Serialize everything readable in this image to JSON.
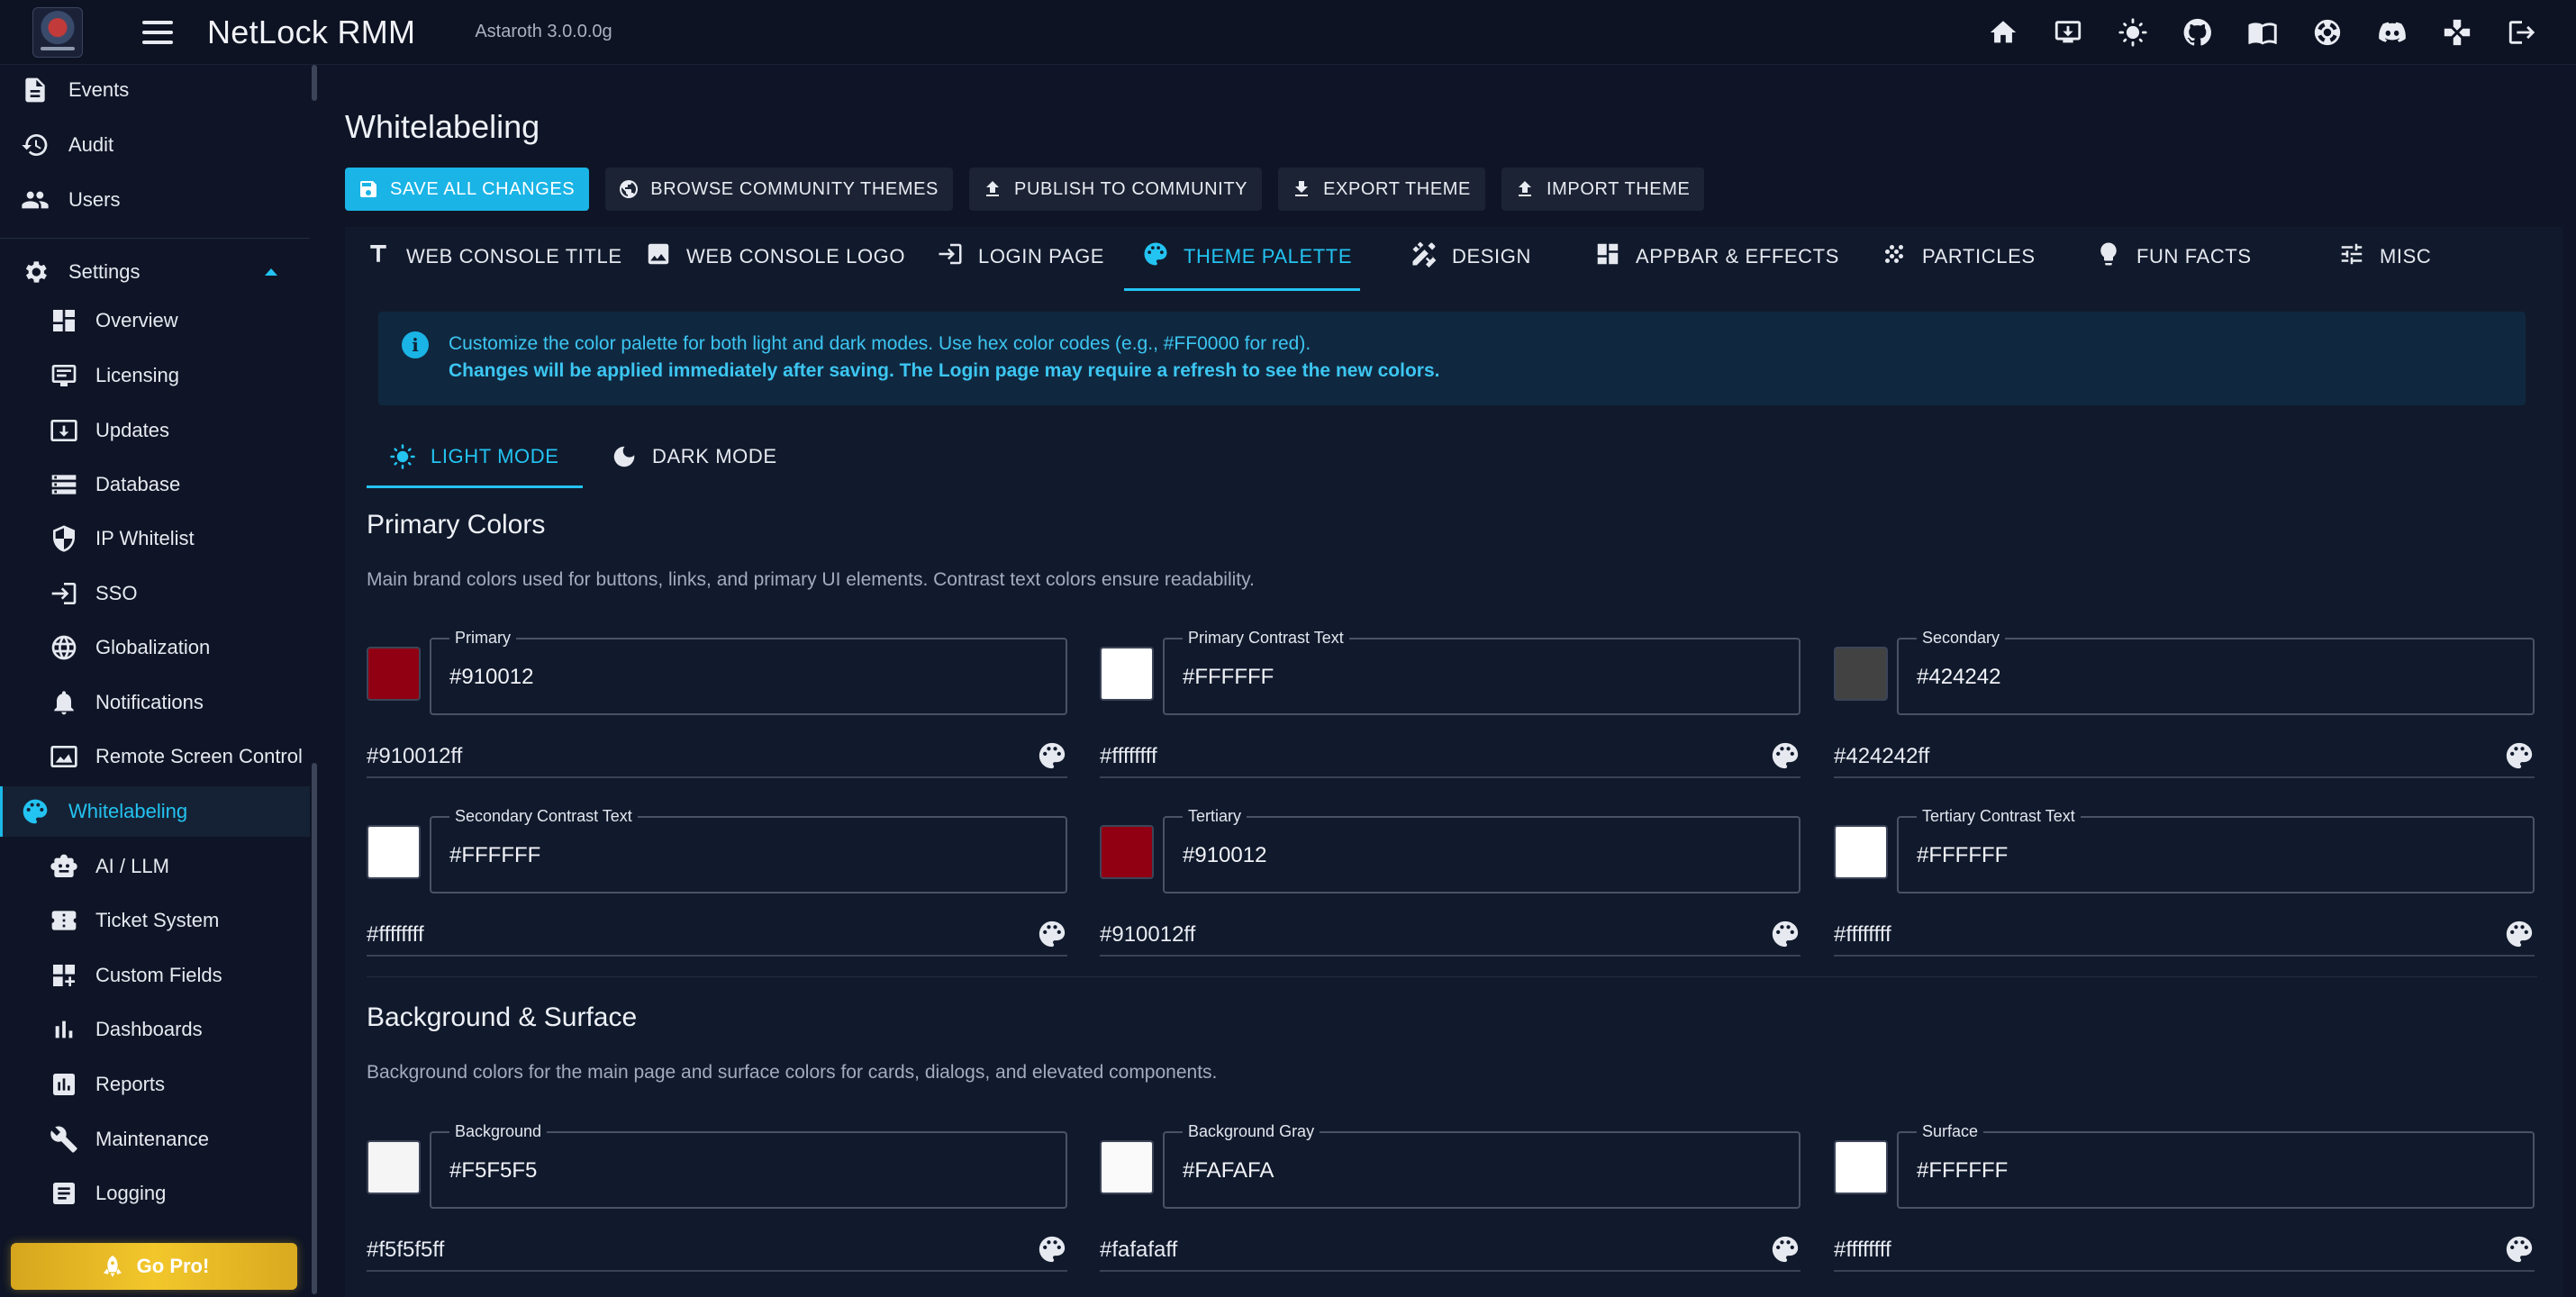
{
  "app": {
    "title": "NetLock RMM",
    "version": "Astaroth 3.0.0.0g"
  },
  "appbar_icons": [
    "home-icon",
    "download-icon",
    "theme-toggle-icon",
    "github-icon",
    "docs-icon",
    "support-icon",
    "discord-icon",
    "game-icon",
    "logout-icon"
  ],
  "sidebar": {
    "top_items": [
      {
        "label": "Events",
        "icon": "document-icon"
      },
      {
        "label": "Audit",
        "icon": "history-icon"
      },
      {
        "label": "Users",
        "icon": "users-icon"
      }
    ],
    "settings": {
      "label": "Settings",
      "icon": "gear-icon",
      "expanded": true
    },
    "sub_items": [
      {
        "label": "Overview",
        "icon": "dashboard-icon"
      },
      {
        "label": "Licensing",
        "icon": "license-icon"
      },
      {
        "label": "Updates",
        "icon": "update-icon"
      },
      {
        "label": "Database",
        "icon": "database-icon"
      },
      {
        "label": "IP Whitelist",
        "icon": "shield-icon"
      },
      {
        "label": "SSO",
        "icon": "login-icon"
      },
      {
        "label": "Globalization",
        "icon": "globe-icon"
      },
      {
        "label": "Notifications",
        "icon": "bell-icon"
      },
      {
        "label": "Remote Screen Control",
        "icon": "screen-icon"
      },
      {
        "label": "Whitelabeling",
        "icon": "palette-icon",
        "active": true
      },
      {
        "label": "AI / LLM",
        "icon": "robot-icon"
      },
      {
        "label": "Ticket System",
        "icon": "ticket-icon"
      },
      {
        "label": "Custom Fields",
        "icon": "custom-fields-icon"
      },
      {
        "label": "Dashboards",
        "icon": "bar-chart-icon"
      },
      {
        "label": "Reports",
        "icon": "report-icon"
      },
      {
        "label": "Maintenance",
        "icon": "wrench-icon"
      },
      {
        "label": "Logging",
        "icon": "log-icon"
      }
    ],
    "go_pro": "Go Pro!"
  },
  "page": {
    "title": "Whitelabeling",
    "toolbar": {
      "save": "SAVE ALL CHANGES",
      "browse": "BROWSE COMMUNITY THEMES",
      "publish": "PUBLISH TO COMMUNITY",
      "export": "EXPORT THEME",
      "import": "IMPORT THEME"
    },
    "tabs": [
      {
        "label": "WEB CONSOLE TITLE",
        "icon": "title-icon"
      },
      {
        "label": "WEB CONSOLE LOGO",
        "icon": "image-icon"
      },
      {
        "label": "LOGIN PAGE",
        "icon": "login-icon"
      },
      {
        "label": "THEME PALETTE",
        "icon": "palette-icon",
        "active": true
      },
      {
        "label": "DESIGN",
        "icon": "design-icon"
      },
      {
        "label": "APPBAR & EFFECTS",
        "icon": "dashboard-icon"
      },
      {
        "label": "PARTICLES",
        "icon": "grain-icon"
      },
      {
        "label": "FUN FACTS",
        "icon": "lightbulb-icon"
      },
      {
        "label": "MISC",
        "icon": "tune-icon"
      }
    ],
    "info": {
      "line1": "Customize the color palette for both light and dark modes. Use hex color codes (e.g., #FF0000 for red).",
      "line2": "Changes will be applied immediately after saving. The Login page may require a refresh to see the new colors."
    },
    "modes": {
      "light": "LIGHT MODE",
      "dark": "DARK MODE",
      "active": "light"
    },
    "sections": [
      {
        "title": "Primary Colors",
        "description": "Main brand colors used for buttons, links, and primary UI elements. Contrast text colors ensure readability.",
        "fields": [
          {
            "label": "Primary",
            "value": "#910012",
            "hex": "#910012ff",
            "color": "#910012"
          },
          {
            "label": "Primary Contrast Text",
            "value": "#FFFFFF",
            "hex": "#ffffffff",
            "color": "#FFFFFF"
          },
          {
            "label": "Secondary",
            "value": "#424242",
            "hex": "#424242ff",
            "color": "#424242"
          },
          {
            "label": "Secondary Contrast Text",
            "value": "#FFFFFF",
            "hex": "#ffffffff",
            "color": "#FFFFFF"
          },
          {
            "label": "Tertiary",
            "value": "#910012",
            "hex": "#910012ff",
            "color": "#910012"
          },
          {
            "label": "Tertiary Contrast Text",
            "value": "#FFFFFF",
            "hex": "#ffffffff",
            "color": "#FFFFFF"
          }
        ]
      },
      {
        "title": "Background & Surface",
        "description": "Background colors for the main page and surface colors for cards, dialogs, and elevated components.",
        "fields": [
          {
            "label": "Background",
            "value": "#F5F5F5",
            "hex": "#f5f5f5ff",
            "color": "#F5F5F5"
          },
          {
            "label": "Background Gray",
            "value": "#FAFAFA",
            "hex": "#fafafaff",
            "color": "#FAFAFA"
          },
          {
            "label": "Surface",
            "value": "#FFFFFF",
            "hex": "#ffffffff",
            "color": "#FFFFFF"
          }
        ]
      }
    ]
  },
  "colors": {
    "accent": "#23c3f2",
    "background": "#0f1526",
    "go_pro": "#f2c72b"
  }
}
